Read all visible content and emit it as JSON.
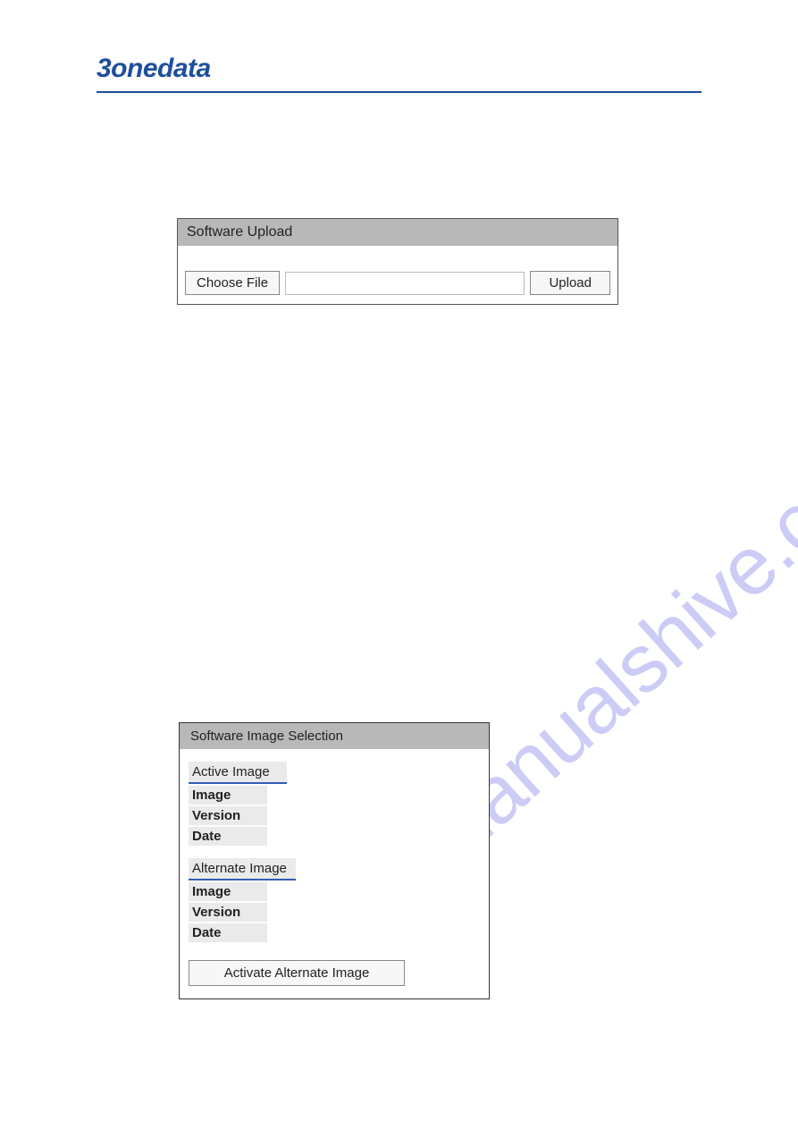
{
  "brand": "3onedata",
  "watermark": "manualshive.com",
  "upload_panel": {
    "title": "Software Upload",
    "choose_label": "Choose File",
    "upload_label": "Upload"
  },
  "image_panel": {
    "title": "Software Image Selection",
    "active": {
      "heading": "Active Image",
      "rows": [
        "Image",
        "Version",
        "Date"
      ]
    },
    "alternate": {
      "heading": "Alternate Image",
      "rows": [
        "Image",
        "Version",
        "Date"
      ]
    },
    "activate_label": "Activate Alternate Image"
  }
}
